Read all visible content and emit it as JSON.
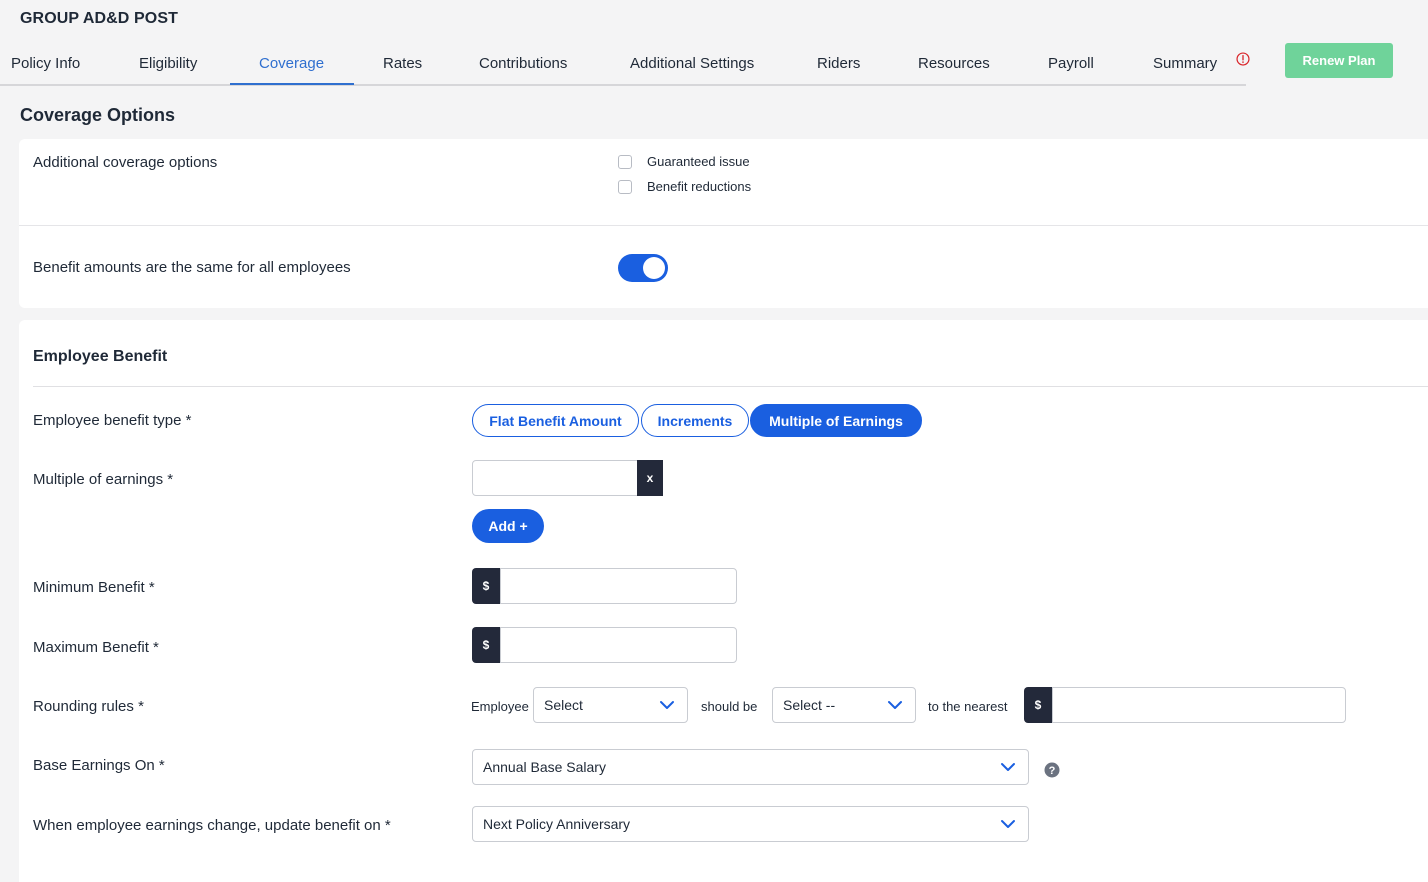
{
  "header": {
    "plan_title": "GROUP AD&D POST",
    "renew_label": "Renew Plan"
  },
  "tabs": [
    {
      "label": "Policy Info"
    },
    {
      "label": "Eligibility"
    },
    {
      "label": "Coverage"
    },
    {
      "label": "Rates"
    },
    {
      "label": "Contributions"
    },
    {
      "label": "Additional Settings"
    },
    {
      "label": "Riders"
    },
    {
      "label": "Resources"
    },
    {
      "label": "Payroll"
    },
    {
      "label": "Summary"
    }
  ],
  "active_tab": "Coverage",
  "coverage_options": {
    "title": "Coverage Options",
    "additional_label": "Additional coverage options",
    "checkboxes": [
      {
        "label": "Guaranteed issue",
        "checked": false
      },
      {
        "label": "Benefit reductions",
        "checked": false
      }
    ],
    "same_benefit_label": "Benefit amounts are the same for all employees",
    "same_benefit_on": true
  },
  "employee_benefit": {
    "title": "Employee Benefit",
    "type_label": "Employee benefit type *",
    "types": [
      "Flat Benefit Amount",
      "Increments",
      "Multiple of Earnings"
    ],
    "selected_type": "Multiple of Earnings",
    "multiple_label": "Multiple of earnings *",
    "multiple_suffix": "x",
    "multiple_value": "",
    "add_label": "Add +",
    "min_label": "Minimum Benefit *",
    "max_label": "Maximum Benefit *",
    "currency_symbol": "$",
    "min_value": "",
    "max_value": "",
    "rounding_label": "Rounding rules *",
    "rounding_employee_text": "Employee",
    "rounding_select1": "Select",
    "rounding_should_be_text": "should be",
    "rounding_select2": "Select --",
    "rounding_nearest_text": "to the nearest",
    "rounding_value": "",
    "base_earnings_label": "Base Earnings On *",
    "base_earnings_value": "Annual Base Salary",
    "update_label": "When employee earnings change, update benefit on *",
    "update_value": "Next Policy Anniversary"
  },
  "colors": {
    "primary": "#1a5fe0",
    "renew": "#6fd39a",
    "addon": "#23293a",
    "alert": "#d9252a"
  },
  "icons": [
    "alert-circle-icon",
    "chevron-down-icon",
    "help-circle-icon"
  ]
}
